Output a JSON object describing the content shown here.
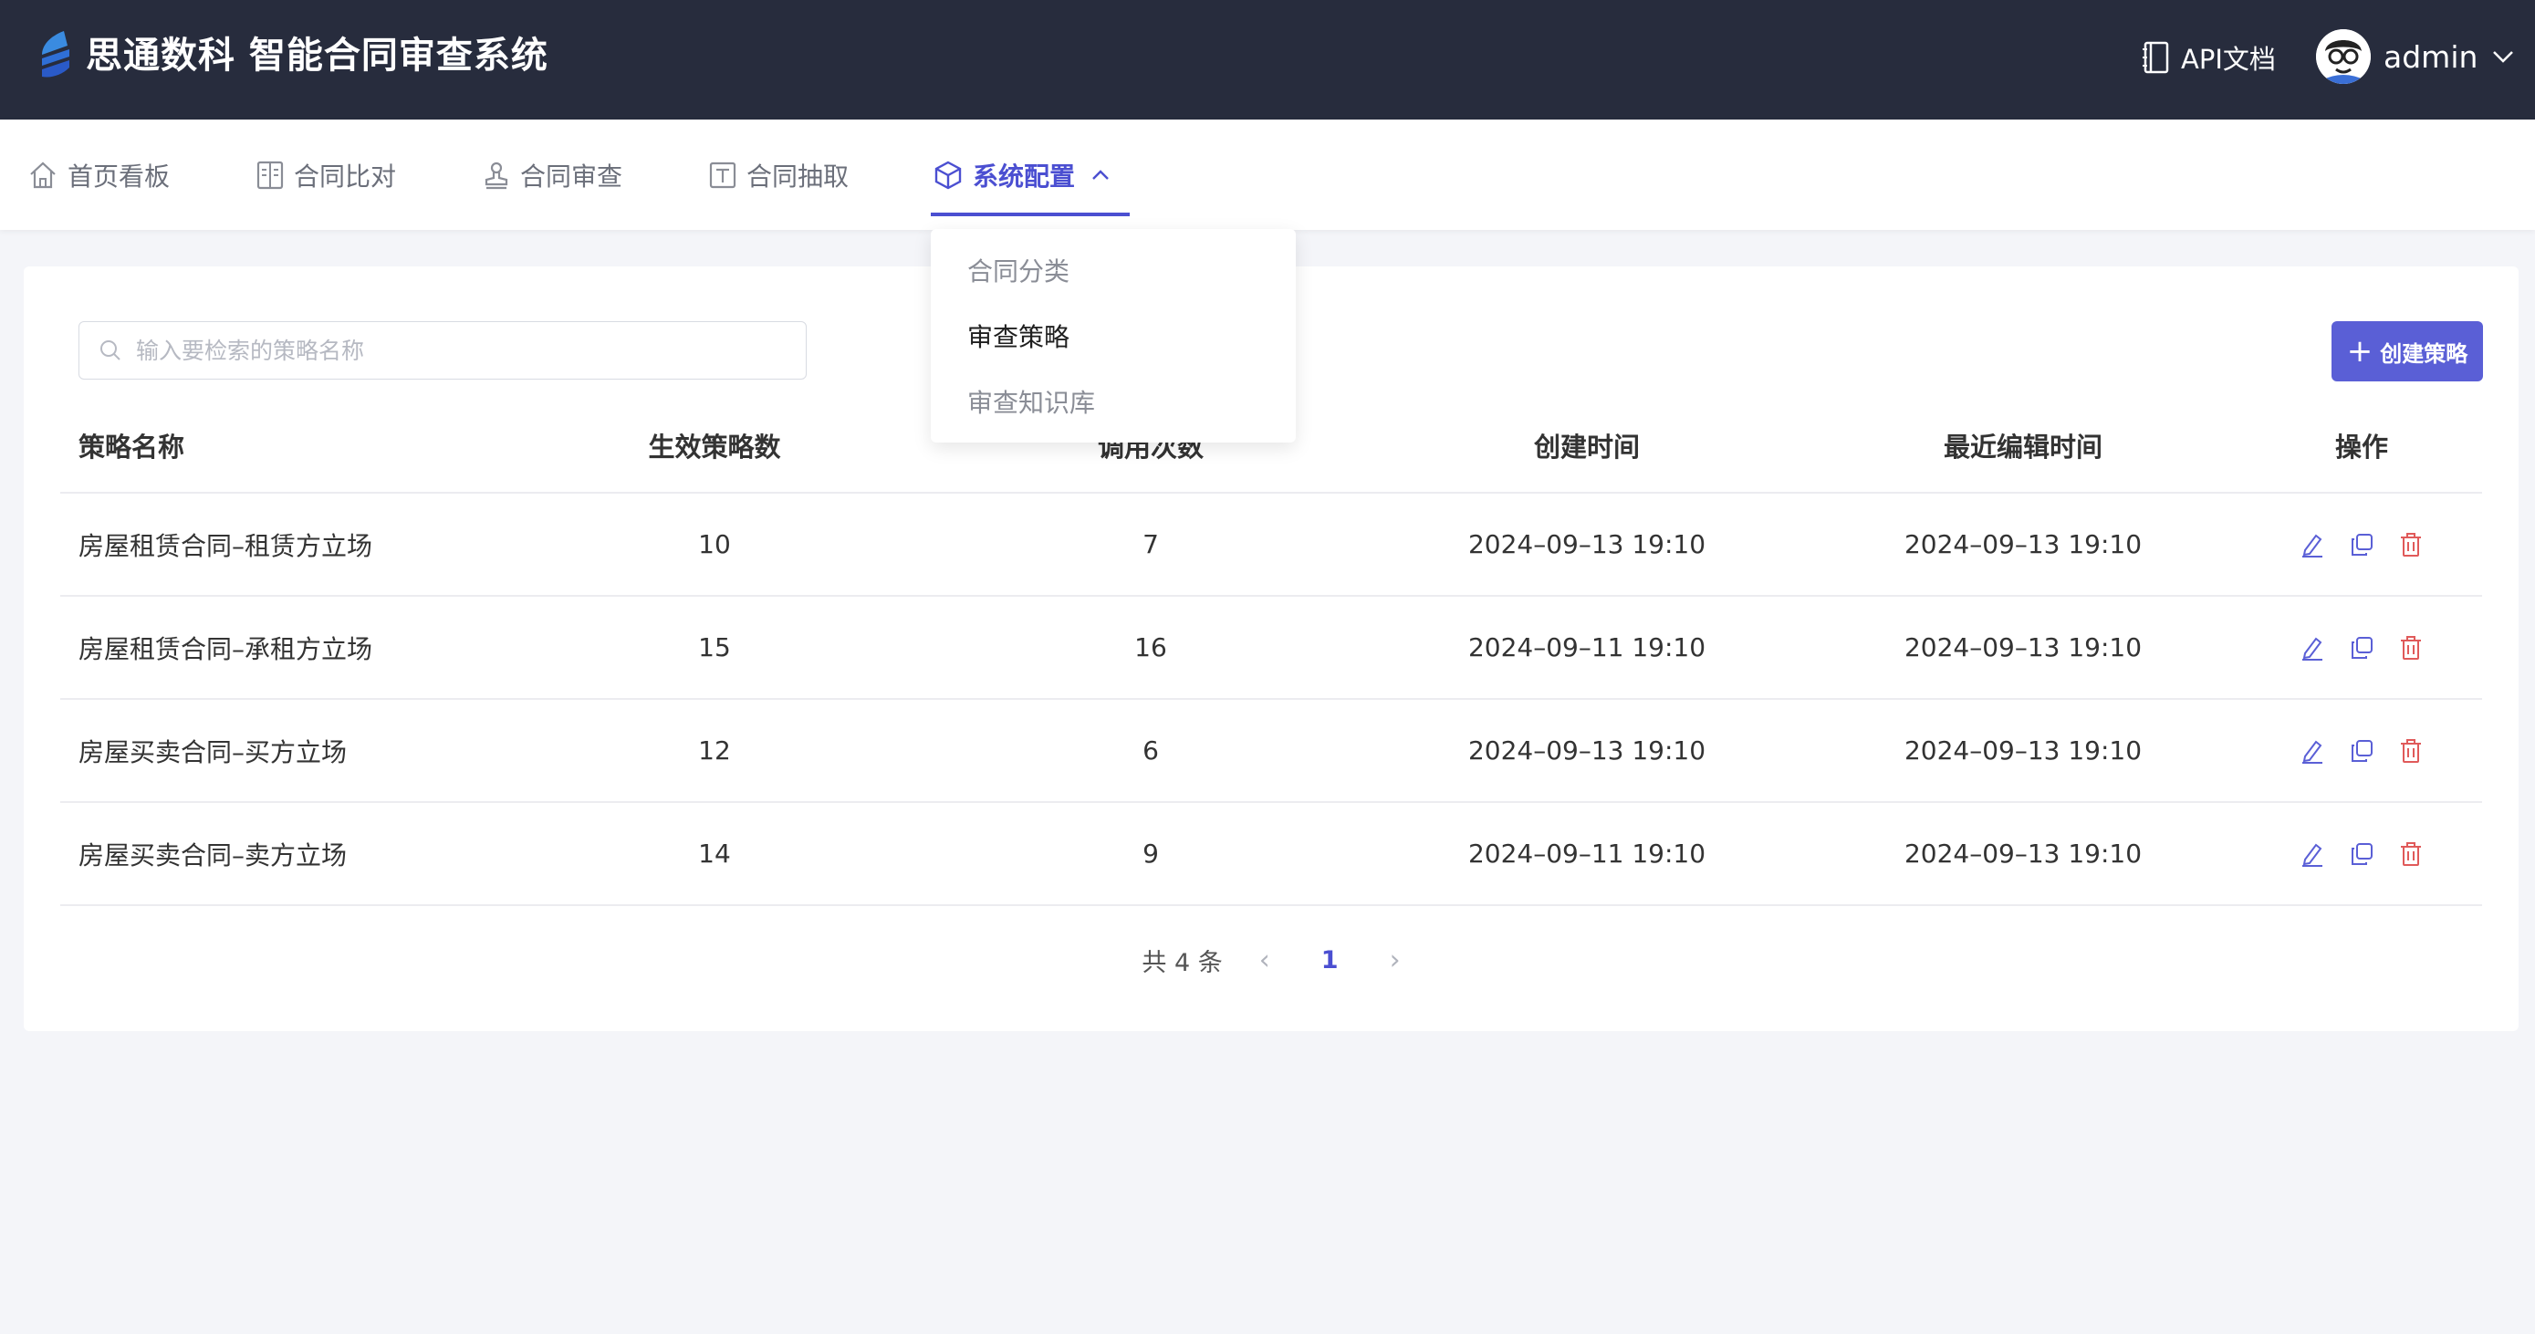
{
  "header": {
    "title": "思通数科 智能合同审查系统",
    "api_label": "API文档",
    "username": "admin"
  },
  "nav": {
    "items": [
      {
        "label": "首页看板"
      },
      {
        "label": "合同比对"
      },
      {
        "label": "合同审查"
      },
      {
        "label": "合同抽取"
      },
      {
        "label": "系统配置"
      }
    ],
    "active_color": "#4b4fd1"
  },
  "dropdown": {
    "items": [
      {
        "label": "合同分类"
      },
      {
        "label": "审查策略"
      },
      {
        "label": "审查知识库"
      }
    ]
  },
  "search": {
    "placeholder": "输入要检索的策略名称"
  },
  "create_button": {
    "label": "创建策略"
  },
  "table": {
    "columns": [
      "策略名称",
      "生效策略数",
      "调用次数",
      "创建时间",
      "最近编辑时间",
      "操作"
    ],
    "rows": [
      {
        "name": "房屋租赁合同–租赁方立场",
        "active": "10",
        "calls": "7",
        "created": "2024–09–13 19:10",
        "edited": "2024–09–13 19:10"
      },
      {
        "name": "房屋租赁合同–承租方立场",
        "active": "15",
        "calls": "16",
        "created": "2024–09–11 19:10",
        "edited": "2024–09–13 19:10"
      },
      {
        "name": "房屋买卖合同–买方立场",
        "active": "12",
        "calls": "6",
        "created": "2024–09–13 19:10",
        "edited": "2024–09–13 19:10"
      },
      {
        "name": "房屋买卖合同–卖方立场",
        "active": "14",
        "calls": "9",
        "created": "2024–09–11 19:10",
        "edited": "2024–09–13 19:10"
      }
    ]
  },
  "pager": {
    "total": "共 4 条",
    "current_page": "1"
  },
  "colors": {
    "header_bg": "#272c3d",
    "accent": "#5a5fd6",
    "danger": "#e05a5a"
  }
}
